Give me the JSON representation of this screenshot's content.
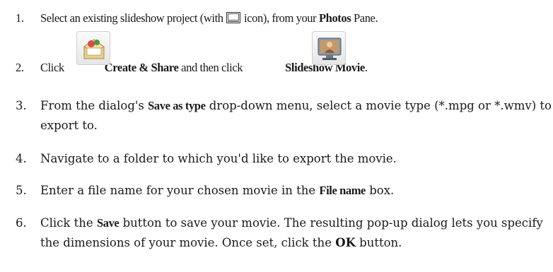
{
  "steps": [
    {
      "number": "1.",
      "before": "Select an existing slideshow project (with ",
      "icon": "slideshow-project-icon",
      "middle": " icon), from your ",
      "bold": "Photos",
      "after": " Pane."
    },
    {
      "number": "2.",
      "click": "Click",
      "button1_icon": "create-share-icon",
      "button1_label": "Create & Share",
      "middle": "and then click",
      "button2_icon": "slideshow-movie-icon",
      "button2_label": "Slideshow Movie",
      "after": "."
    },
    {
      "number": "3.",
      "before": "From the dialog's ",
      "bold": "Save as type",
      "after": " drop-down menu, select a movie type (*.mpg or *.wmv) to export to."
    },
    {
      "number": "4.",
      "text": "Navigate to a folder to which you'd like to export the movie."
    },
    {
      "number": "5.",
      "before": "Enter a file name for your chosen movie in the ",
      "bold": "File name",
      "after": " box."
    },
    {
      "number": "6.",
      "before": "Click the ",
      "bold1": "Save",
      "middle": " button to save your movie. The resulting pop-up dialog lets you specify the dimensions of your movie. Once set, click the ",
      "bold2": "OK",
      "after": " button."
    }
  ],
  "colors": {
    "text": "#1a1a1a",
    "background": "#ffffff"
  }
}
